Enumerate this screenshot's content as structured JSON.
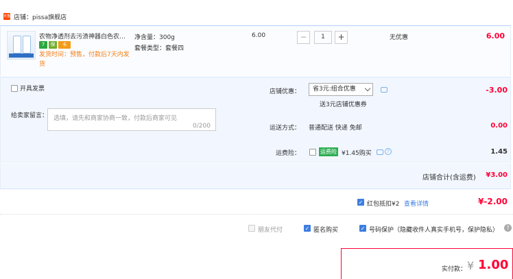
{
  "store": {
    "icon_text": "天猫",
    "name": "店铺：pissa旗舰店"
  },
  "product": {
    "title": "农物净透剂去污渍神器白色农物彩漂粉",
    "badges": [
      "7",
      "保",
      "卡"
    ],
    "ship_note": "发货时间：预售，付款后7天内发货",
    "attr_weight": "净含量：300g",
    "attr_pkg": "套餐类型：套餐四",
    "unit_price": "6.00",
    "qty_minus": "−",
    "qty_value": "1",
    "qty_plus": "+",
    "promo": "无优惠",
    "line_total": "6.00"
  },
  "invoice": {
    "label": "开具发票"
  },
  "note": {
    "label": "给卖家留言：",
    "placeholder": "选填，请先和商家协商一致，付款后商家可见",
    "count": "0/200"
  },
  "shop_promo": {
    "label": "店铺优惠：",
    "selected": "省3元:组合优惠",
    "sub": "送3元店铺优惠券",
    "amount": "-3.00"
  },
  "shipping": {
    "label": "运送方式：",
    "value": "普通配送 快递 免邮",
    "amount": "0.00"
  },
  "insurance": {
    "label": "运费险：",
    "badge": "运费险",
    "text": "¥1.45购买",
    "help": "?",
    "amount": "1.45"
  },
  "subtotal": {
    "label": "店铺合计(含运费)",
    "amount": "¥3.00"
  },
  "redpacket": {
    "label": "红包抵扣¥2",
    "link": "查看详情",
    "amount": "¥-2.00"
  },
  "options": {
    "friend": "朋友代付",
    "anonymous": "匿名购买",
    "protect": "号码保护（隐藏收件人真实手机号，保护隐私）",
    "help": "?"
  },
  "pay": {
    "label": "实付款：",
    "currency": "¥",
    "amount": "1.00"
  },
  "colors": {
    "accent": "#ff0036",
    "link": "#3d7ee0",
    "panel": "#f2f7ff"
  }
}
